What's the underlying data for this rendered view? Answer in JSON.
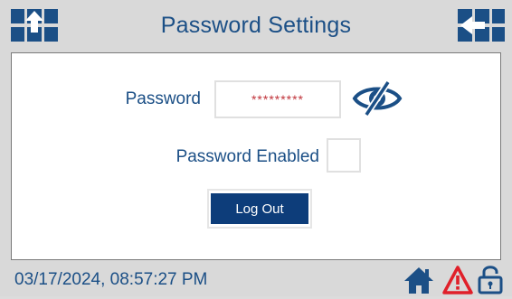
{
  "header": {
    "title": "Password Settings",
    "left_icon": "transfer-up-icon",
    "right_icon": "transfer-left-icon"
  },
  "form": {
    "password_label": "Password",
    "password_value": "*********",
    "password_visibility_icon": "eye-slash-icon",
    "enabled_label": "Password Enabled",
    "enabled_checked": false,
    "logout_label": "Log Out"
  },
  "footer": {
    "datetime": "03/17/2024, 08:57:27 PM",
    "icons": [
      "home-icon",
      "alarm-warning-icon",
      "unlocked-padlock-icon"
    ]
  },
  "colors": {
    "accent": "#1b4f86",
    "button": "#0d3d7a",
    "alarm": "#e0202a",
    "password_text": "#c0343b",
    "background": "#d9d9d9"
  }
}
